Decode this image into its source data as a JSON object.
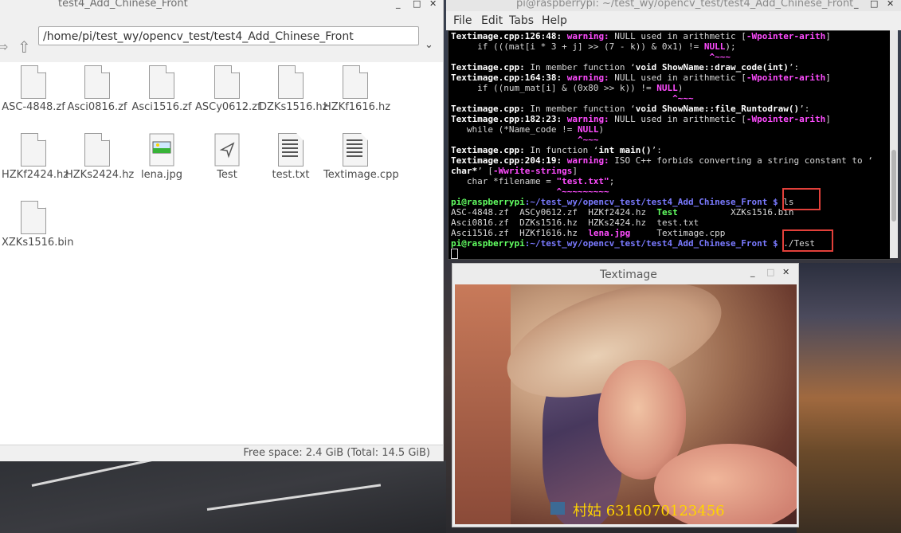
{
  "file_manager": {
    "title": "test4_Add_Chinese_Front",
    "path": "/home/pi/test_wy/opencv_test/test4_Add_Chinese_Front",
    "status": "Free space: 2.4 GiB (Total: 14.5 GiB)",
    "files": [
      {
        "name": "ASC-4848.zf",
        "type": "doc"
      },
      {
        "name": "Asci0816.zf",
        "type": "doc"
      },
      {
        "name": "Asci1516.zf",
        "type": "doc"
      },
      {
        "name": "ASCy0612.zf",
        "type": "doc"
      },
      {
        "name": "DZKs1516.hz",
        "type": "doc"
      },
      {
        "name": "HZKf1616.hz",
        "type": "doc"
      },
      {
        "name": "HZKf2424.hz",
        "type": "doc"
      },
      {
        "name": "HZKs2424.hz",
        "type": "doc"
      },
      {
        "name": "lena.jpg",
        "type": "image"
      },
      {
        "name": "Test",
        "type": "exec"
      },
      {
        "name": "test.txt",
        "type": "text"
      },
      {
        "name": "Textimage.cpp",
        "type": "text"
      },
      {
        "name": "XZKs1516.bin",
        "type": "doc"
      }
    ]
  },
  "terminal": {
    "title": "pi@raspberrypi: ~/test_wy/opencv_test/test4_Add_Chinese_Front",
    "menu": [
      "File",
      "Edit",
      "Tabs",
      "Help"
    ],
    "lines": {
      "l1_file": "Textimage.cpp:126:48:",
      "l1_warn": "warning:",
      "l1_msg": " NULL used in arithmetic [",
      "l1_flag": "-Wpointer-arith",
      "l2": "     if (((mat[i * 3 + j] >> (7 - k)) & 0x1) != ",
      "l2_null": "NULL",
      "l3": "                                                 ^~~~",
      "l4_file": "Textimage.cpp:",
      "l4_msg": " In member function ‘",
      "l4_fn": "void ShowName::draw_code(int)",
      "l5_file": "Textimage.cpp:164:38:",
      "l5_msg": " NULL used in arithmetic [",
      "l6": "     if ((num_mat[i] & (0x80 >> k)) != ",
      "l7": "                                          ^~~~",
      "l8_fn": "void ShowName::file_Runtodraw()",
      "l9_file": "Textimage.cpp:182:23:",
      "l10": "   while (*Name_code != ",
      "l11": "                        ^~~~",
      "l12_msg": " In function ‘",
      "l12_fn": "int main()",
      "l13_file": "Textimage.cpp:204:19:",
      "l13_msg": " ISO C++ forbids converting a string constant to ‘",
      "l14_char": "char*",
      "l14_flag": "-Wwrite-strings",
      "l15": "   char *filename = ",
      "l15_str": "\"test.txt\"",
      "l16": "                    ^~~~~~~~~~",
      "prompt_user": "pi@raspberrypi",
      "prompt_path": ":~/test_wy/opencv_test/test4_Add_Chinese_Front $",
      "cmd1": " ls",
      "ls_row1": [
        "ASC-4848.zf",
        "ASCy0612.zf",
        "HZKf2424.hz",
        "Test",
        "XZKs1516.bin"
      ],
      "ls_row2": [
        "Asci0816.zf",
        "DZKs1516.hz",
        "HZKs2424.hz",
        "test.txt"
      ],
      "ls_row3": [
        "Asci1516.zf",
        "HZKf1616.hz",
        "lena.jpg",
        "Textimage.cpp"
      ],
      "cmd2": " ./Test"
    }
  },
  "image_window": {
    "title": "Textimage",
    "overlay_text": "村姑  6316070123456"
  },
  "colors": {
    "highlight_box": "#e2403a",
    "overlay_text": "#ffd400",
    "terminal_bg": "#000000"
  }
}
